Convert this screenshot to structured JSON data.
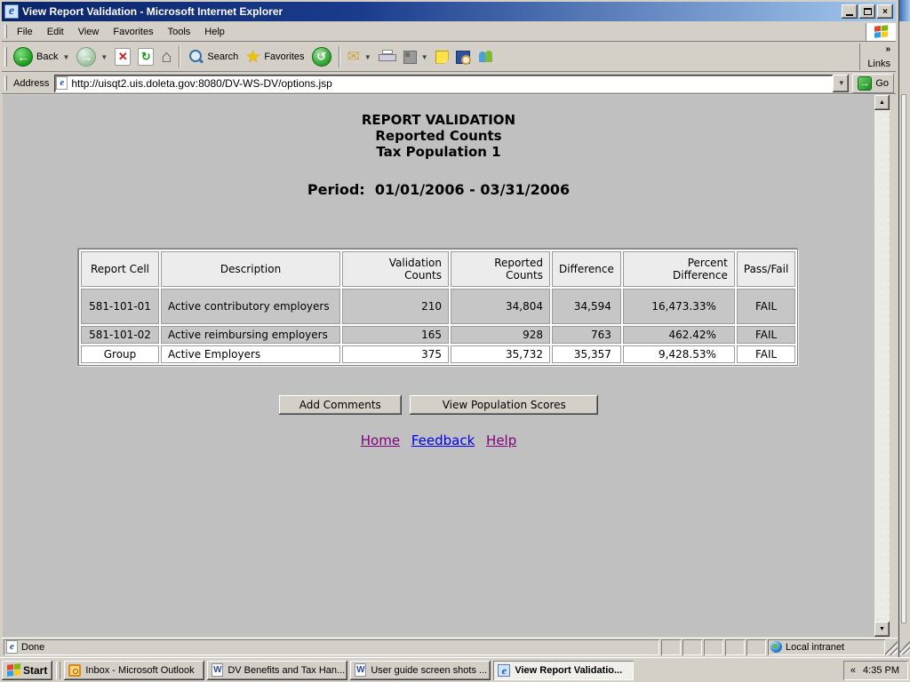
{
  "colors": {
    "titlebar_gradient_start": "#0a246a",
    "titlebar_gradient_end": "#a6caf0",
    "chrome_gray": "#d4d0c8",
    "page_background": "#c0c0c0",
    "table_header_bg": "#ececec",
    "table_row_bg": "#c6c6c6",
    "link_visited": "#800080",
    "link_unvisited": "#0000ee",
    "go_button_green": "#1d8b1d"
  },
  "window": {
    "title": "View Report Validation - Microsoft Internet Explorer",
    "menu": {
      "file": "File",
      "edit": "Edit",
      "view": "View",
      "favorites": "Favorites",
      "tools": "Tools",
      "help": "Help"
    },
    "toolbar": {
      "back": "Back",
      "search": "Search",
      "favorites": "Favorites",
      "links": "Links",
      "links_chevron": "»"
    },
    "address": {
      "label": "Address",
      "url": "http://uisqt2.uis.doleta.gov:8080/DV-WS-DV/options.jsp",
      "go": "Go"
    }
  },
  "page": {
    "title_line1": "REPORT VALIDATION",
    "title_line2": "Reported Counts",
    "title_line3": "Tax Population 1",
    "period": "Period:  01/01/2006 - 03/31/2006",
    "table": {
      "headers": [
        "Report Cell",
        "Description",
        "Validation Counts",
        "Reported Counts",
        "Difference",
        "Percent Difference",
        "Pass/Fail"
      ],
      "rows": [
        {
          "cell": "581-101-01",
          "desc": "Active contributory employers",
          "validation": "210",
          "reported": "34,804",
          "difference": "34,594",
          "percent": "16,473.33%",
          "pass": "FAIL"
        },
        {
          "cell": "581-101-02",
          "desc": "Active reimbursing employers",
          "validation": "165",
          "reported": "928",
          "difference": "763",
          "percent": "462.42%",
          "pass": "FAIL"
        },
        {
          "cell": "Group",
          "desc": "Active Employers",
          "validation": "375",
          "reported": "35,732",
          "difference": "35,357",
          "percent": "9,428.53%",
          "pass": "FAIL"
        }
      ]
    },
    "buttons": {
      "add_comments": "Add Comments",
      "view_population_scores": "View Population Scores"
    },
    "links": {
      "home": "Home",
      "feedback": "Feedback",
      "help": "Help"
    }
  },
  "statusbar": {
    "status": "Done",
    "zone": "Local intranet"
  },
  "taskbar": {
    "start": "Start",
    "tasks": [
      {
        "label": "Inbox - Microsoft Outlook"
      },
      {
        "label": "DV Benefits and Tax Han..."
      },
      {
        "label": "User guide screen shots ..."
      },
      {
        "label": "View Report Validatio..."
      }
    ],
    "tray": {
      "chevron": "«",
      "time": "4:35 PM"
    }
  }
}
